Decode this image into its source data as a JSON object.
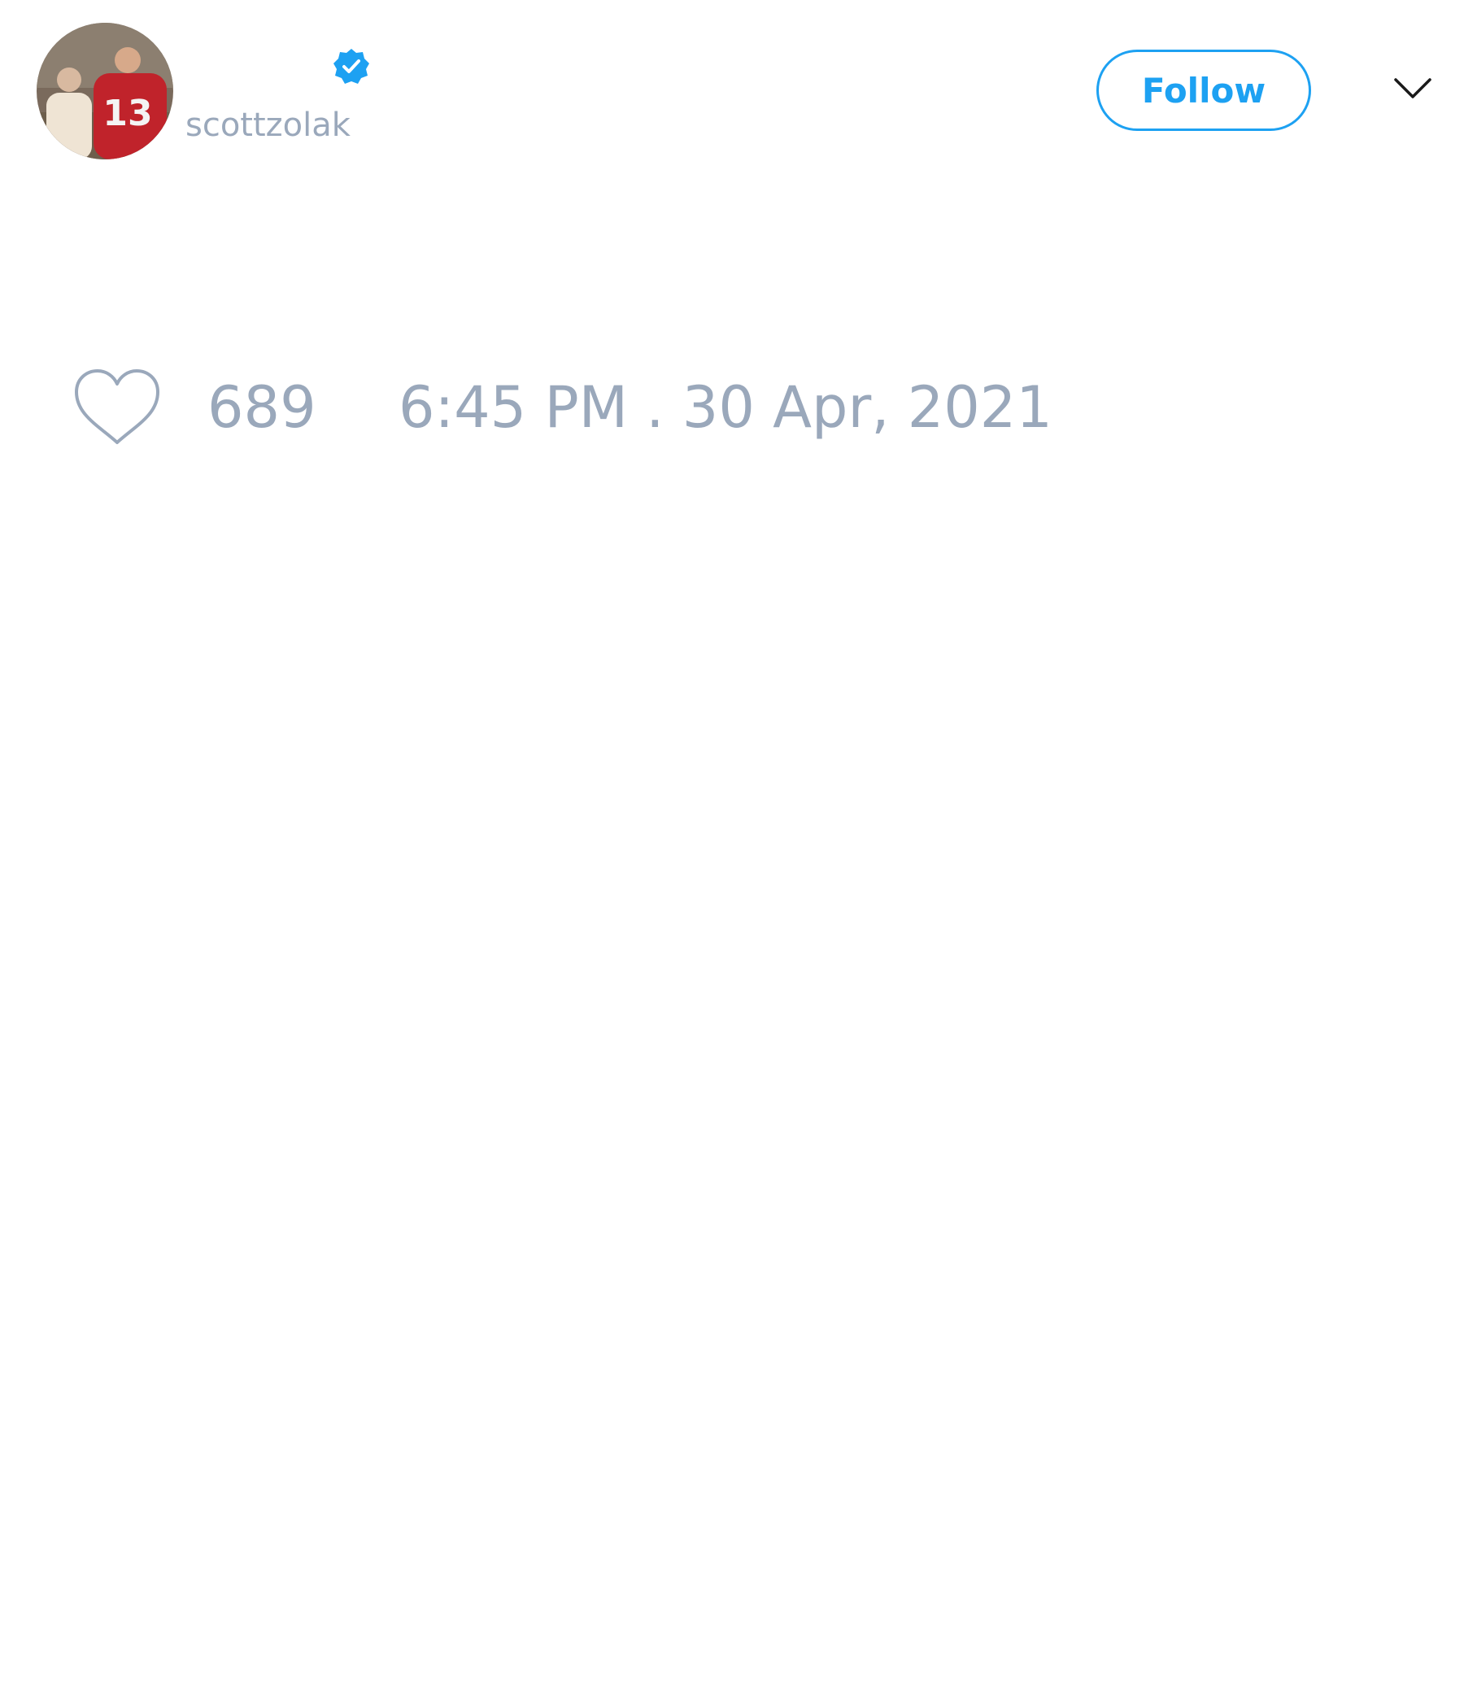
{
  "tweet": {
    "author": {
      "handle": "scottzolak",
      "avatar_icon": "avatar-photo",
      "verified_icon": "verified-badge-icon"
    },
    "follow_label": "Follow",
    "menu_icon": "chevron-down-icon",
    "like_icon": "heart-icon",
    "like_count": "689",
    "timestamp": "6:45 PM . 30 Apr, 2021"
  },
  "colors": {
    "accent": "#1da1f2",
    "muted_text": "#9aa8bb",
    "background": "#ffffff"
  }
}
